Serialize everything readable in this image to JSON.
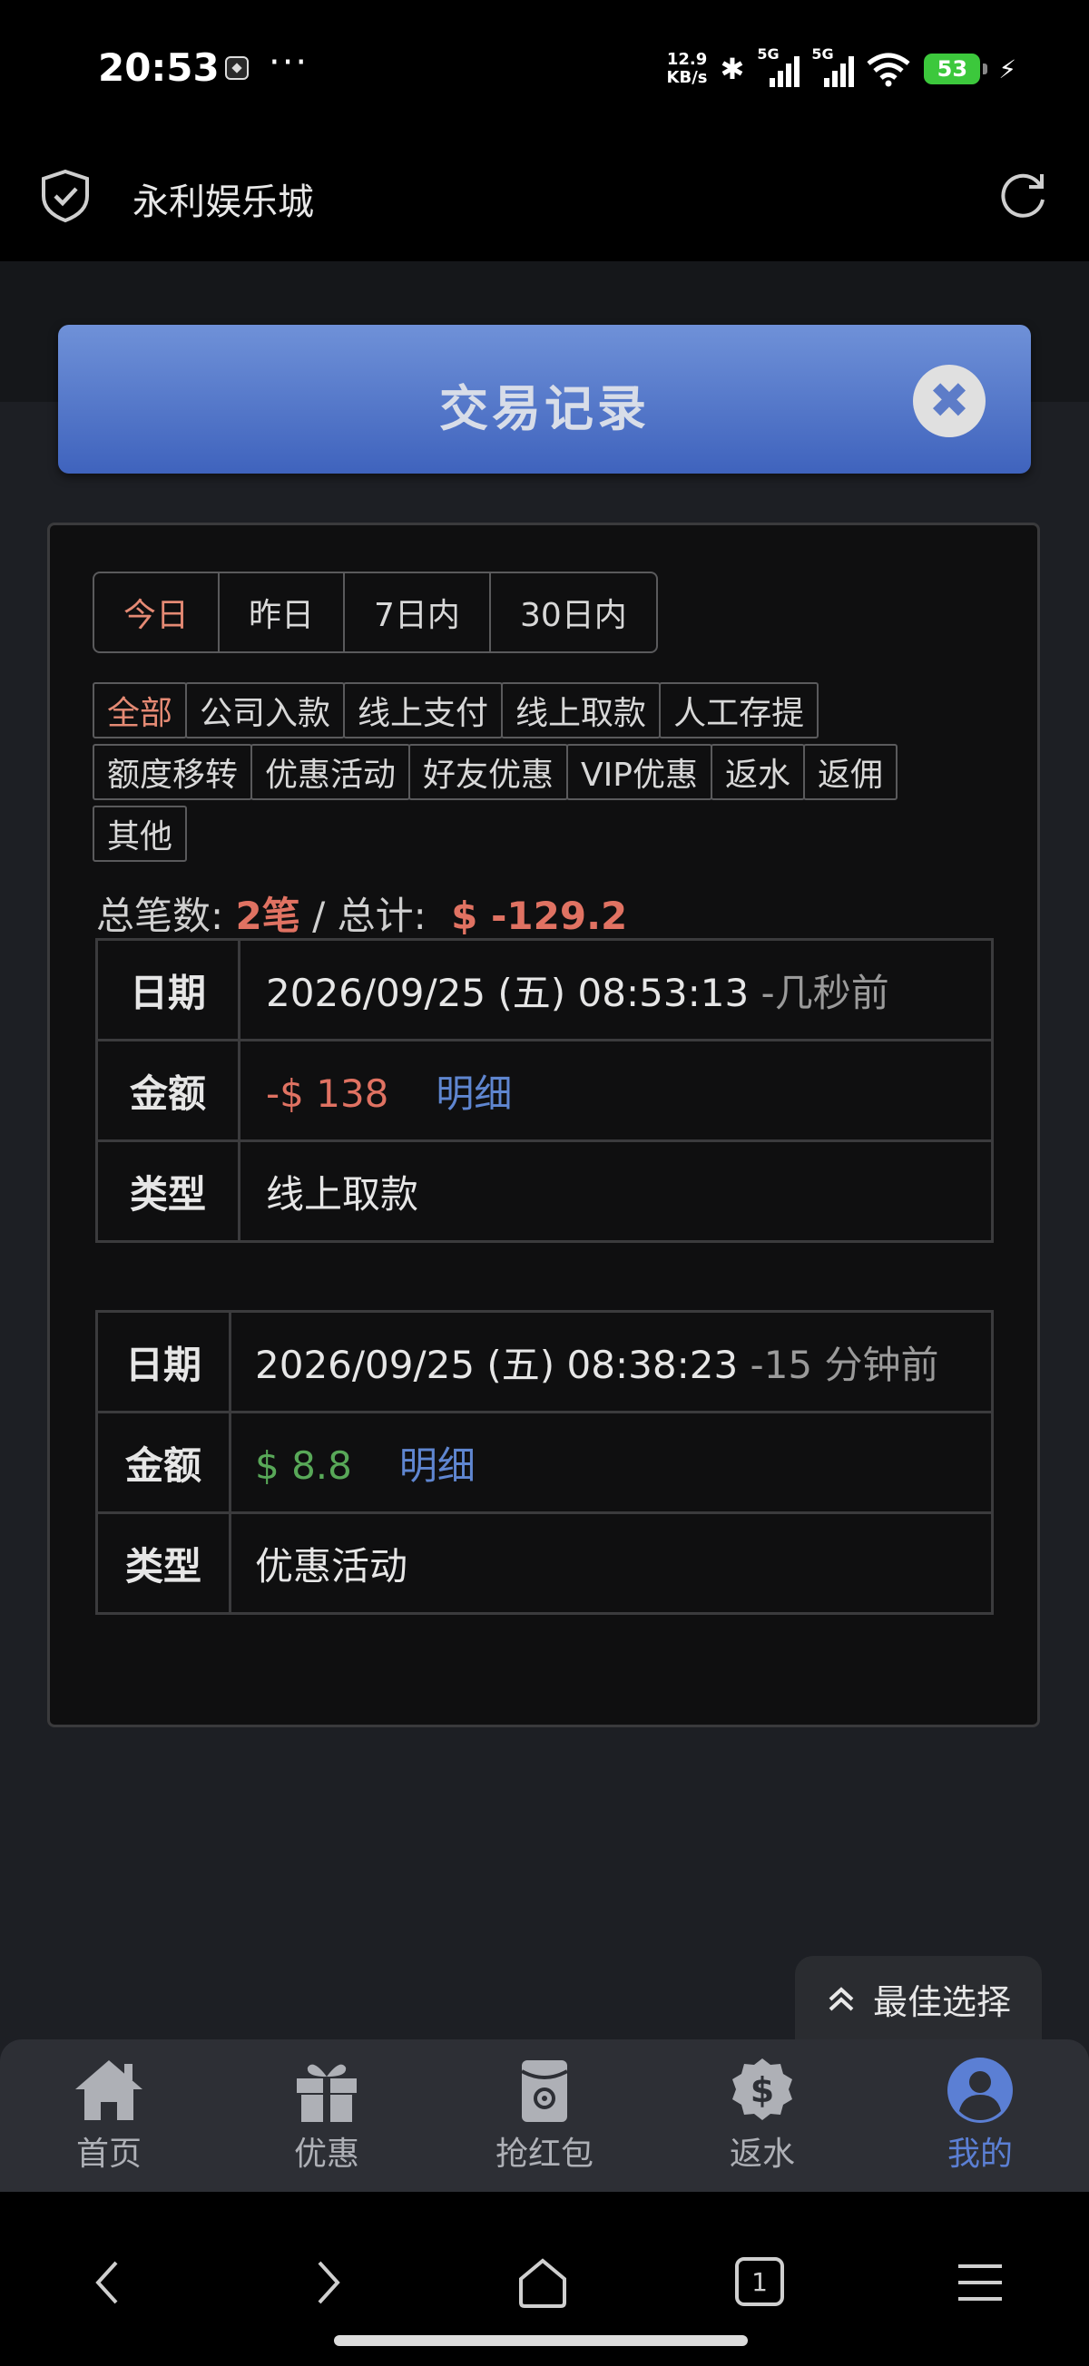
{
  "status_bar": {
    "time": "20:53",
    "dots": "···",
    "speed_value": "12.9",
    "speed_unit": "KB/s",
    "signal1_label": "5G",
    "signal2_label": "5G",
    "battery": "53",
    "icons": [
      "app-notification-icon",
      "bluetooth-icon",
      "signal-icon",
      "signal-icon",
      "wifi-icon",
      "battery-icon",
      "charging-icon"
    ]
  },
  "browser": {
    "title": "永利娱乐城",
    "icons": [
      "shield-check-icon",
      "reload-icon"
    ]
  },
  "modal": {
    "title": "交易记录",
    "close_symbol": "✖"
  },
  "date_tabs": [
    {
      "label": "今日",
      "active": true
    },
    {
      "label": "昨日",
      "active": false
    },
    {
      "label": "7日内",
      "active": false
    },
    {
      "label": "30日内",
      "active": false
    }
  ],
  "filters": [
    {
      "label": "全部",
      "active": true
    },
    {
      "label": "公司入款"
    },
    {
      "label": "线上支付"
    },
    {
      "label": "线上取款"
    },
    {
      "label": "人工存提"
    },
    {
      "label": "额度移转"
    },
    {
      "label": "优惠活动"
    },
    {
      "label": "好友优惠"
    },
    {
      "label": "VIP优惠"
    },
    {
      "label": "返水"
    },
    {
      "label": "返佣"
    },
    {
      "label": "其他"
    }
  ],
  "summary": {
    "count_label": "总笔数:",
    "count_value": "2笔",
    "separator": "/",
    "total_label": "总计:",
    "total_value": "$ -129.2"
  },
  "records": [
    {
      "date_label": "日期",
      "date": "2026/09/25 (五) 08:53:13",
      "ago": "-几秒前",
      "amount_label": "金额",
      "amount": "-$ 138",
      "detail": "明细",
      "type_label": "类型",
      "type": "线上取款"
    },
    {
      "date_label": "日期",
      "date": "2026/09/25 (五) 08:38:23",
      "ago": "-15 分钟前",
      "amount_label": "金额",
      "amount": "$ 8.8",
      "detail": "明细",
      "type_label": "类型",
      "type": "优惠活动"
    }
  ],
  "best_choice": {
    "label": "最佳选择",
    "icon": "double-chevron-up-icon"
  },
  "bottom_nav": [
    {
      "label": "首页",
      "icon": "home-icon"
    },
    {
      "label": "优惠",
      "icon": "gift-icon"
    },
    {
      "label": "抢红包",
      "icon": "red-envelope-icon"
    },
    {
      "label": "返水",
      "icon": "dollar-badge-icon"
    },
    {
      "label": "我的",
      "icon": "user-icon",
      "active": true
    }
  ],
  "system_nav": {
    "tab_count": "1",
    "icons": [
      "back-icon",
      "forward-icon",
      "home-outline-icon",
      "tabs-icon",
      "menu-icon"
    ]
  },
  "colors": {
    "accent_red": "#e07262",
    "accent_green": "#58a858",
    "link_blue": "#5f86d0",
    "header_blue": "#4f73c8",
    "nav_active": "#5b7fd4"
  }
}
